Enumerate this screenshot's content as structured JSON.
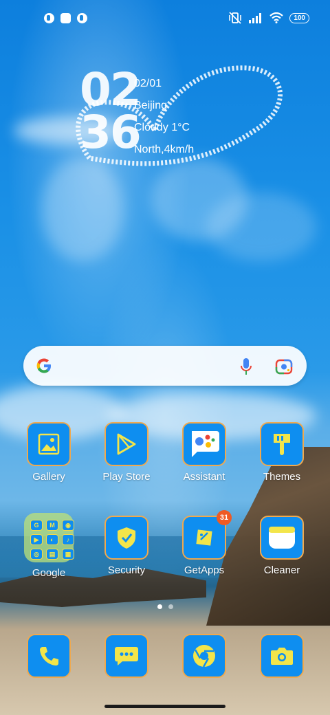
{
  "status_bar": {
    "battery": "100"
  },
  "clock": {
    "hour": "02",
    "minute": "36"
  },
  "weather": {
    "date": "02/01",
    "city": "Beijing",
    "condition": "Cloudy 1°C",
    "wind": "North,4km/h"
  },
  "apps_row1": [
    {
      "label": "Gallery",
      "icon": "gallery-icon"
    },
    {
      "label": "Play Store",
      "icon": "play-store-icon"
    },
    {
      "label": "Assistant",
      "icon": "assistant-icon"
    },
    {
      "label": "Themes",
      "icon": "themes-brush-icon"
    }
  ],
  "apps_row2": [
    {
      "label": "Google",
      "icon": "folder-icon"
    },
    {
      "label": "Security",
      "icon": "security-shield-icon"
    },
    {
      "label": "GetApps",
      "icon": "getapps-icon",
      "badge": "31"
    },
    {
      "label": "Cleaner",
      "icon": "cleaner-icon"
    }
  ],
  "folder_items": [
    "G",
    "M",
    "◉",
    "▶",
    "◐",
    "♪",
    "◎",
    "▤",
    "▦"
  ],
  "dock": [
    {
      "icon": "phone-icon"
    },
    {
      "icon": "messages-icon"
    },
    {
      "icon": "chrome-icon"
    },
    {
      "icon": "camera-icon"
    }
  ],
  "colors": {
    "icon_bg": "#0e8ef0",
    "icon_border": "#f0a94e",
    "icon_glyph": "#f3e54a",
    "badge": "#ef5a24"
  }
}
